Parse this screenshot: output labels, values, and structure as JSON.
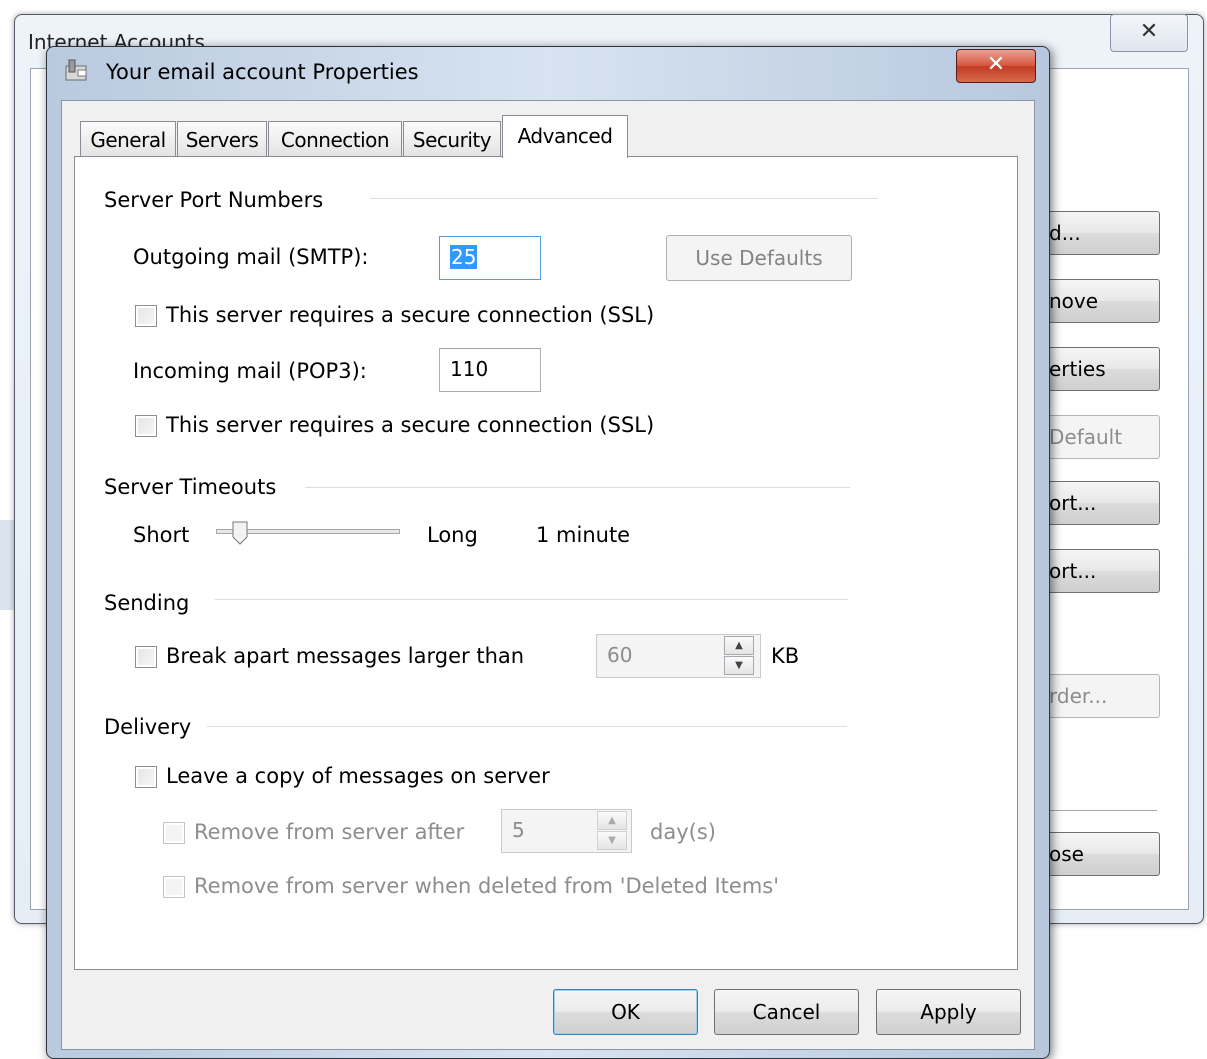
{
  "background_window": {
    "title": "Internet Accounts",
    "close_glyph": "✕",
    "buttons": [
      {
        "label": "Add...",
        "visible": "d...",
        "enabled": true
      },
      {
        "label": "Remove",
        "visible": "nove",
        "enabled": true
      },
      {
        "label": "Properties",
        "visible": "erties",
        "enabled": true
      },
      {
        "label": "Set as Default",
        "visible": "Default",
        "enabled": false
      },
      {
        "label": "Import...",
        "visible": "ort...",
        "enabled": true
      },
      {
        "label": "Export...",
        "visible": "ort...",
        "enabled": true
      },
      {
        "label": "Set Order...",
        "visible": "rder...",
        "enabled": false
      },
      {
        "label": "Close",
        "visible": "ose",
        "enabled": true
      }
    ]
  },
  "dialog": {
    "title": "Your email account Properties",
    "close_glyph": "✕",
    "tabs": [
      {
        "label": "General",
        "active": false
      },
      {
        "label": "Servers",
        "active": false
      },
      {
        "label": "Connection",
        "active": false
      },
      {
        "label": "Security",
        "active": false
      },
      {
        "label": "Advanced",
        "active": true
      }
    ],
    "ports": {
      "heading": "Server Port Numbers",
      "smtp_label": "Outgoing mail (SMTP):",
      "smtp_value": "25",
      "use_defaults": "Use Defaults",
      "smtp_ssl": "This server requires a secure connection (SSL)",
      "pop3_label": "Incoming mail (POP3):",
      "pop3_value": "110",
      "pop3_ssl": "This server requires a secure connection (SSL)"
    },
    "timeouts": {
      "heading": "Server Timeouts",
      "short": "Short",
      "long": "Long",
      "value_text": "1 minute",
      "slider_fraction": 0.08
    },
    "sending": {
      "heading": "Sending",
      "break_apart": "Break apart messages larger than",
      "size_value": "60",
      "unit": "KB"
    },
    "delivery": {
      "heading": "Delivery",
      "leave_copy": "Leave a copy of messages on server",
      "remove_after": "Remove from server after",
      "days_value": "5",
      "days_unit": "day(s)",
      "remove_deleted": "Remove from server when deleted from 'Deleted Items'"
    },
    "footer": {
      "ok": "OK",
      "cancel": "Cancel",
      "apply": "Apply"
    }
  }
}
